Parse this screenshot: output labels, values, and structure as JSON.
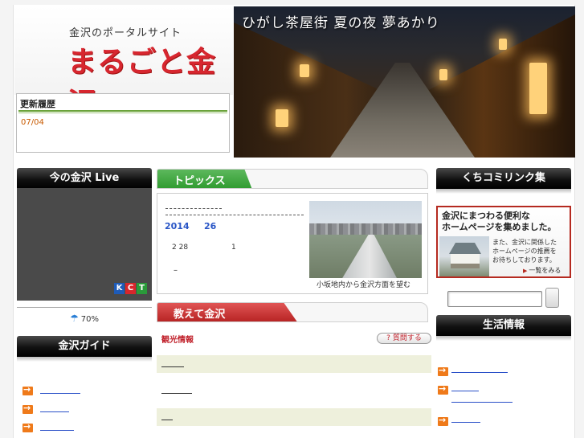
{
  "header": {
    "site_subtitle": "金沢のポータルサイト",
    "site_title": "まるごと金沢",
    "update_history_title": "更新履歴",
    "update_history_date": "07/04",
    "hero_title": "ひがし茶屋街 夏の夜 夢あかり"
  },
  "left": {
    "live_title": "今の金沢 Live",
    "kct_letters": [
      "K",
      "C",
      "T"
    ],
    "kct_colors": [
      "#1e5bb8",
      "#d8262c",
      "#2a9a3a"
    ],
    "weather_icon": "umbrella-icon",
    "weather_value": "70%",
    "guide_title": "金沢ガイド"
  },
  "center": {
    "topics_title": "トピックス",
    "topics_year": "2014",
    "topics_day": "26",
    "topics_line_a": "2  28",
    "topics_line_b": "1",
    "topics_line_c": "–",
    "photo_caption": "小坂地内から金沢方面を望む",
    "oshiete_title": "教えて金沢",
    "category_label": "観光情報",
    "ask_button_label": "質問する"
  },
  "right": {
    "kuchikomi_title": "くちコミリンク集",
    "banner_title": "金沢にまつわる便利な\nホームページを集めました。",
    "banner_text": "また、金沢に関係した\nホームページの推薦を\nお待ちしております。",
    "banner_more": "一覧をみる",
    "search_placeholder": "",
    "life_title": "生活情報"
  },
  "colors": {
    "brand_red": "#d7262f",
    "topics_green": "#3aa13a",
    "oshiete_red": "#c0202a",
    "link_blue": "#2a50c8",
    "arrow_orange": "#ef7a1a"
  }
}
